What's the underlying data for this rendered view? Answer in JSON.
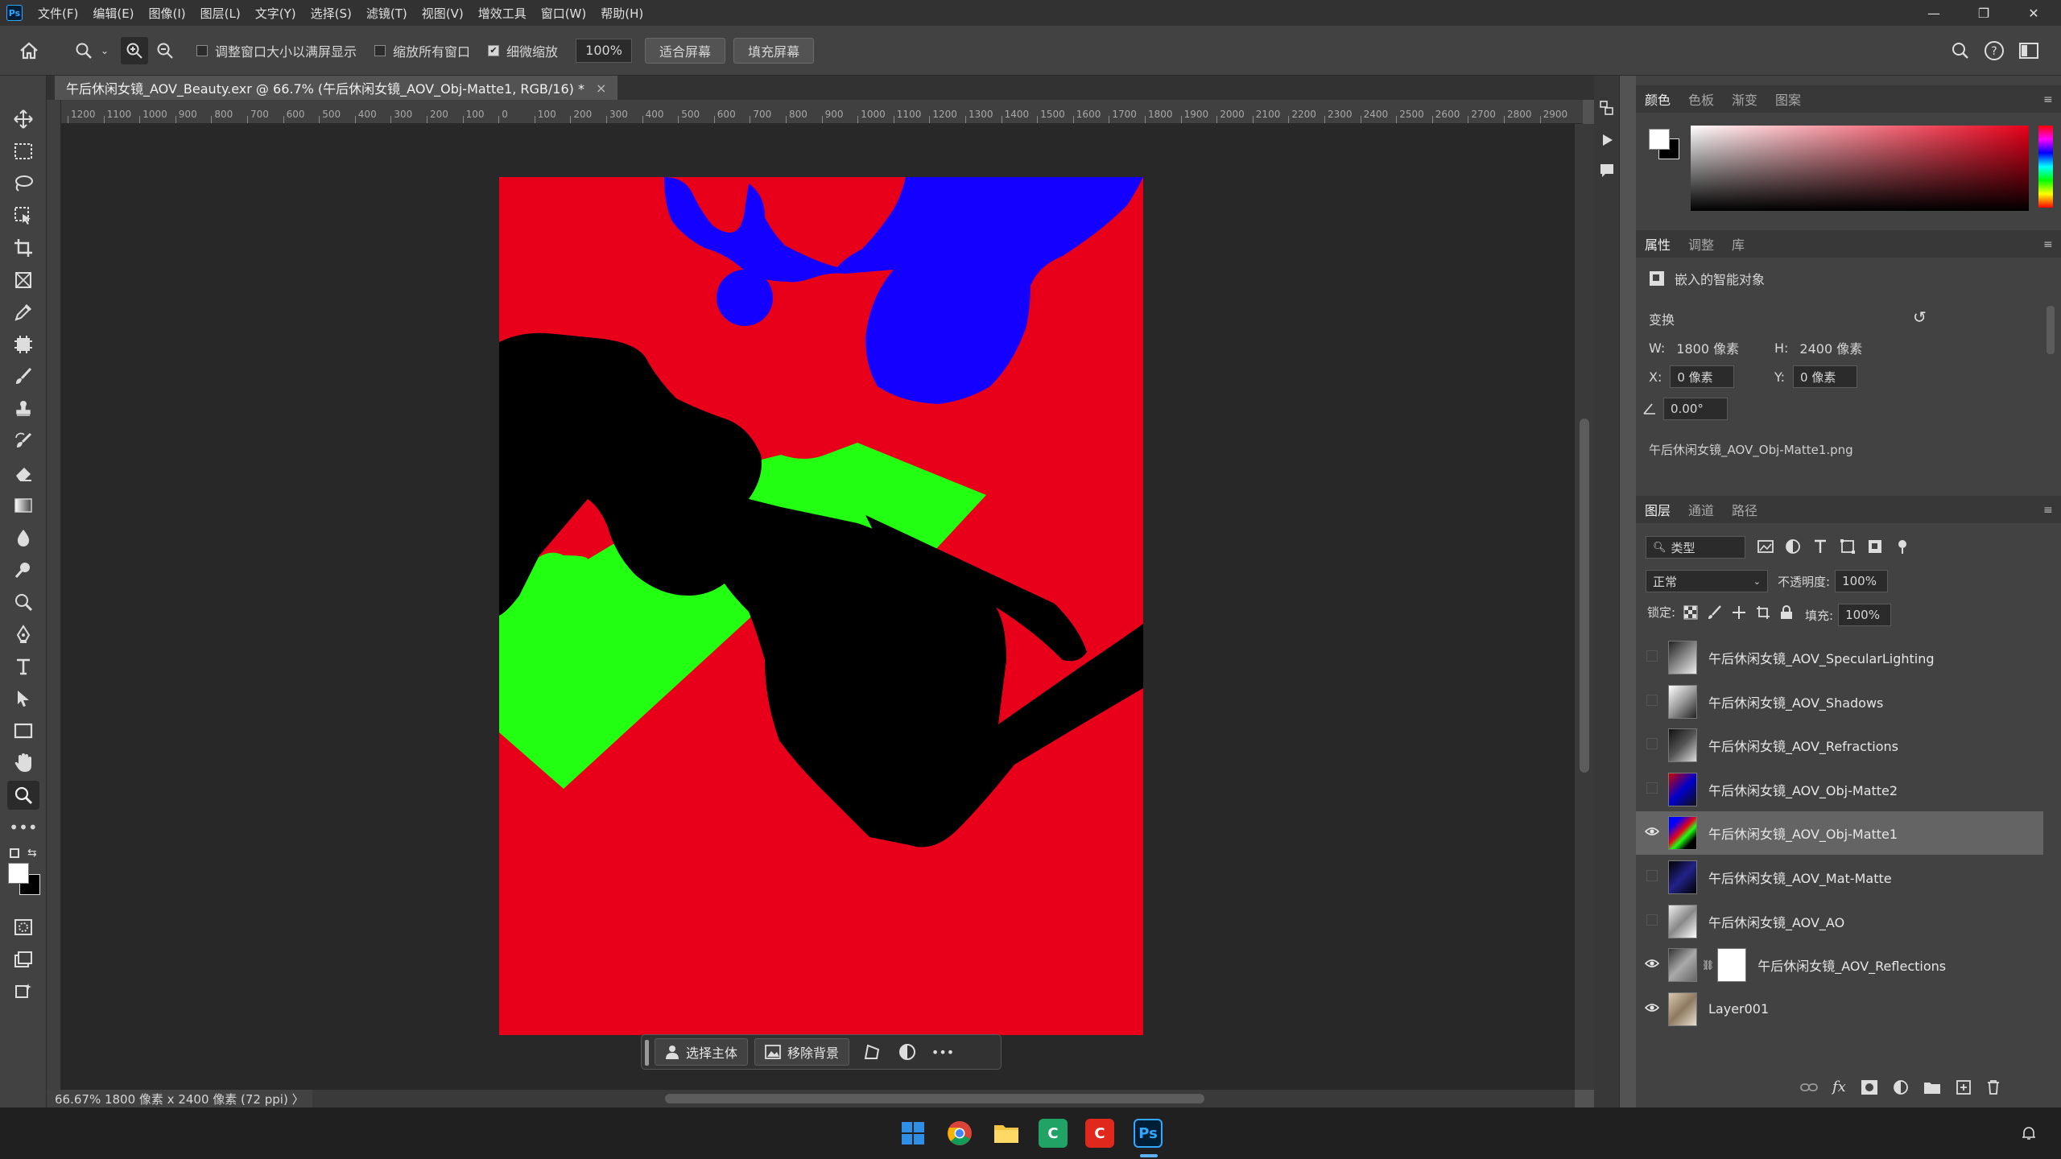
{
  "menubar": {
    "logo": "Ps",
    "items": [
      "文件(F)",
      "编辑(E)",
      "图像(I)",
      "图层(L)",
      "文字(Y)",
      "选择(S)",
      "滤镜(T)",
      "视图(V)",
      "增效工具",
      "窗口(W)",
      "帮助(H)"
    ],
    "minimize": "—",
    "restore": "❐",
    "close": "✕"
  },
  "options": {
    "resize_windows": "调整窗口大小以满屏显示",
    "zoom_all": "缩放所有窗口",
    "scrubby_zoom": "细微缩放",
    "zoom_value": "100%",
    "fit_screen": "适合屏幕",
    "fill_screen": "填充屏幕"
  },
  "document": {
    "tab_title": "午后休闲女镜_AOV_Beauty.exr @ 66.7% (午后休闲女镜_AOV_Obj-Matte1, RGB/16) *",
    "tab_close": "×",
    "status": "66.67%  1800 像素 x 2400 像素 (72 ppi)  〉"
  },
  "ruler": {
    "labels": [
      "1200",
      "1100",
      "1000",
      "900",
      "800",
      "700",
      "600",
      "500",
      "400",
      "300",
      "200",
      "100",
      "0",
      "100",
      "200",
      "300",
      "400",
      "500",
      "600",
      "700",
      "800",
      "900",
      "1000",
      "1100",
      "1200",
      "1300",
      "1400",
      "1500",
      "1600",
      "1700",
      "1800",
      "1900",
      "2000",
      "2100",
      "2200",
      "2300",
      "2400",
      "2500",
      "2600",
      "2700",
      "2800",
      "2900"
    ]
  },
  "context_bar": {
    "select_subject": "选择主体",
    "remove_bg": "移除背景",
    "more": "•••"
  },
  "color_panel": {
    "tabs": [
      "颜色",
      "色板",
      "渐变",
      "图案"
    ]
  },
  "properties": {
    "tabs": [
      "属性",
      "调整",
      "库"
    ],
    "type": "嵌入的智能对象",
    "transform_label": "变换",
    "w_label": "W:",
    "w_value": "1800 像素",
    "h_label": "H:",
    "h_value": "2400 像素",
    "x_label": "X:",
    "x_value": "0 像素",
    "y_label": "Y:",
    "y_value": "0 像素",
    "angle_value": "0.00°",
    "filename": "午后休闲女镜_AOV_Obj-Matte1.png"
  },
  "layers": {
    "tabs": [
      "图层",
      "通道",
      "路径"
    ],
    "filter_label": "类型",
    "blend_mode": "正常",
    "opacity_label": "不透明度:",
    "opacity_value": "100%",
    "lock_label": "锁定:",
    "fill_label": "填充:",
    "fill_value": "100%",
    "items": [
      {
        "name": "午后休闲女镜_AOV_SpecularLighting",
        "visible": false
      },
      {
        "name": "午后休闲女镜_AOV_Shadows",
        "visible": false
      },
      {
        "name": "午后休闲女镜_AOV_Refractions",
        "visible": false
      },
      {
        "name": "午后休闲女镜_AOV_Obj-Matte2",
        "visible": false
      },
      {
        "name": "午后休闲女镜_AOV_Obj-Matte1",
        "visible": true
      },
      {
        "name": "午后休闲女镜_AOV_Mat-Matte",
        "visible": false
      },
      {
        "name": "午后休闲女镜_AOV_AO",
        "visible": false
      },
      {
        "name": "午后休闲女镜_AOV_Reflections",
        "visible": true
      },
      {
        "name": "Layer001",
        "visible": true
      }
    ],
    "fx_label": "fx"
  },
  "taskbar": {
    "ps_label": "Ps"
  },
  "colors": {
    "matte_red": "#e8001a",
    "matte_green": "#22ff12",
    "matte_blue": "#1400ff"
  }
}
